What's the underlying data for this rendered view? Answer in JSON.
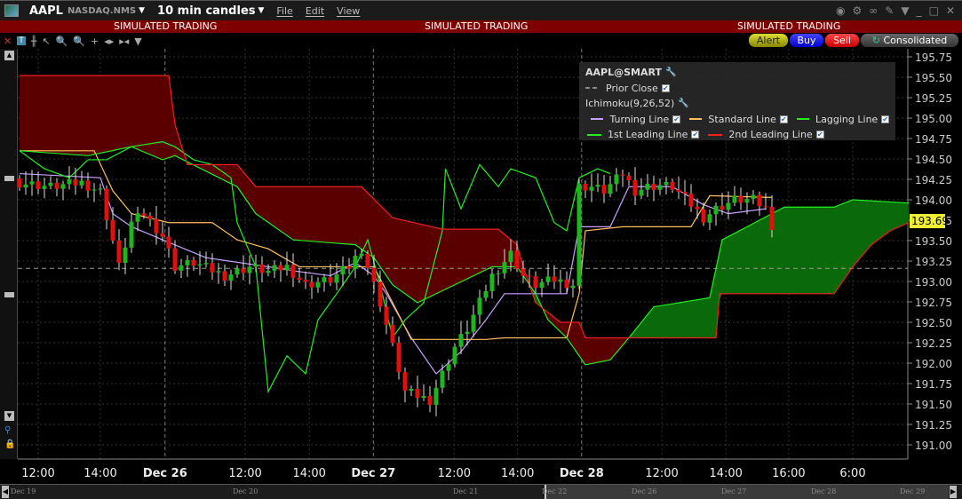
{
  "title": {
    "symbol": "AAPL",
    "exchange": "NASDAQ.NMS",
    "interval": "10 min candles",
    "menus": [
      "File",
      "Edit",
      "View"
    ]
  },
  "sim_banner": "SIMULATED TRADING",
  "buttons": {
    "alert": "Alert",
    "buy": "Buy",
    "sell": "Sell",
    "consolidated": "Consolidated"
  },
  "legend": {
    "header": "AAPL@SMART",
    "prior_close": "Prior Close",
    "study": "Ichimoku(9,26,52)",
    "lines": [
      {
        "label": "Turning Line",
        "color": "#c9a0ff"
      },
      {
        "label": "Standard Line",
        "color": "#ffc060"
      },
      {
        "label": "Lagging Line",
        "color": "#22ee22"
      },
      {
        "label": "1st Leading Line",
        "color": "#22ee22"
      },
      {
        "label": "2nd Leading Line",
        "color": "#ee2020"
      }
    ]
  },
  "current_price": "193.69",
  "navigator": [
    "Dec 19",
    "Dec 20",
    "Dec 21",
    "Dec 22",
    "Dec 26",
    "Dec 27",
    "Dec 28",
    "Dec 29"
  ],
  "chart_data": {
    "type": "candlestick",
    "title": "AAPL 10 min candles",
    "ylim": [
      190.85,
      195.9
    ],
    "xlim": [
      -0.3,
      143
    ],
    "yticks": [
      "195.75",
      "195.50",
      "195.25",
      "195.00",
      "194.75",
      "194.50",
      "194.25",
      "194.00",
      "193.75",
      "193.50",
      "193.25",
      "193.00",
      "192.75",
      "192.50",
      "192.25",
      "192.00",
      "191.75",
      "191.50",
      "191.25",
      "191.00"
    ],
    "xticks": [
      {
        "bar": 3,
        "label": "12:00"
      },
      {
        "bar": 13,
        "label": "14:00"
      },
      {
        "bar": 23.4,
        "label": "Dec 26",
        "bold": true
      },
      {
        "bar": 36.3,
        "label": "12:00"
      },
      {
        "bar": 46.6,
        "label": "14:00"
      },
      {
        "bar": 56.9,
        "label": "Dec 27",
        "bold": true
      },
      {
        "bar": 69.9,
        "label": "12:00"
      },
      {
        "bar": 80.1,
        "label": "14:00"
      },
      {
        "bar": 90.4,
        "label": "Dec 28",
        "bold": true
      },
      {
        "bar": 103.3,
        "label": "12:00"
      },
      {
        "bar": 113.6,
        "label": "14:00"
      },
      {
        "bar": 123.7,
        "label": "16:00"
      },
      {
        "bar": 134,
        "label": "6:00"
      }
    ],
    "prior_close": 193.16,
    "close_path": [
      [
        0,
        194.21
      ],
      [
        5,
        194.16
      ],
      [
        10,
        194.21
      ],
      [
        13,
        194.1
      ],
      [
        15,
        193.5
      ],
      [
        16,
        193.18
      ],
      [
        18,
        193.72
      ],
      [
        20,
        193.83
      ],
      [
        23,
        193.56
      ],
      [
        25,
        193.18
      ],
      [
        28,
        193.23
      ],
      [
        33,
        193.07
      ],
      [
        37,
        193.18
      ],
      [
        40,
        193.12
      ],
      [
        43,
        193.18
      ],
      [
        46,
        192.96
      ],
      [
        50,
        193.02
      ],
      [
        53,
        193.18
      ],
      [
        55,
        193.4
      ],
      [
        56,
        193.18
      ],
      [
        58,
        192.74
      ],
      [
        60,
        192.2
      ],
      [
        62,
        191.65
      ],
      [
        64,
        191.6
      ],
      [
        66,
        191.55
      ],
      [
        68,
        191.87
      ],
      [
        70,
        192.2
      ],
      [
        72,
        192.42
      ],
      [
        74,
        192.74
      ],
      [
        76,
        193.07
      ],
      [
        79,
        193.34
      ],
      [
        81,
        193.07
      ],
      [
        83,
        192.96
      ],
      [
        86,
        193.02
      ],
      [
        89,
        192.96
      ],
      [
        90,
        194.16
      ],
      [
        92,
        194.16
      ],
      [
        94,
        194.11
      ],
      [
        97,
        194.32
      ],
      [
        99,
        194.11
      ],
      [
        101,
        194.16
      ],
      [
        103,
        194.18
      ],
      [
        105,
        194.16
      ],
      [
        108,
        193.94
      ],
      [
        110,
        193.78
      ],
      [
        112,
        193.89
      ],
      [
        115,
        194.0
      ],
      [
        118,
        194.0
      ],
      [
        120,
        193.89
      ],
      [
        121,
        193.69
      ]
    ],
    "series": [
      {
        "name": "Turning Line",
        "points": [
          [
            0,
            194.32
          ],
          [
            13,
            194.27
          ],
          [
            15,
            193.83
          ],
          [
            18,
            193.67
          ],
          [
            23,
            193.51
          ],
          [
            30,
            193.29
          ],
          [
            40,
            193.18
          ],
          [
            45,
            193.12
          ],
          [
            50,
            193.07
          ],
          [
            54,
            193.23
          ],
          [
            57,
            193.07
          ],
          [
            59,
            192.85
          ],
          [
            63,
            192.31
          ],
          [
            67,
            191.87
          ],
          [
            71,
            192.14
          ],
          [
            75,
            192.53
          ],
          [
            78,
            192.85
          ],
          [
            82,
            192.85
          ],
          [
            88,
            192.85
          ],
          [
            90,
            193.67
          ],
          [
            95,
            193.67
          ],
          [
            98,
            194.16
          ],
          [
            105,
            194.16
          ],
          [
            110,
            193.94
          ],
          [
            114,
            193.83
          ],
          [
            120,
            193.89
          ]
        ]
      },
      {
        "name": "Standard Line",
        "points": [
          [
            0,
            194.6
          ],
          [
            12,
            194.6
          ],
          [
            15,
            194.11
          ],
          [
            18,
            193.83
          ],
          [
            24,
            193.72
          ],
          [
            31,
            193.72
          ],
          [
            35,
            193.51
          ],
          [
            40,
            193.4
          ],
          [
            45,
            193.18
          ],
          [
            53,
            193.18
          ],
          [
            57,
            193.18
          ],
          [
            60,
            192.74
          ],
          [
            63,
            192.29
          ],
          [
            68,
            192.29
          ],
          [
            75,
            192.29
          ],
          [
            78,
            192.31
          ],
          [
            88,
            192.31
          ],
          [
            90,
            192.85
          ],
          [
            91,
            193.62
          ],
          [
            97,
            193.67
          ],
          [
            108,
            193.67
          ],
          [
            111,
            194.05
          ],
          [
            120,
            194.03
          ],
          [
            121,
            194.03
          ]
        ]
      },
      {
        "name": "Lagging Line",
        "points": [
          [
            0,
            194.6
          ],
          [
            4,
            194.38
          ],
          [
            8,
            194.27
          ],
          [
            11,
            194.49
          ],
          [
            14,
            194.49
          ],
          [
            18,
            194.65
          ],
          [
            23,
            194.71
          ],
          [
            25,
            194.65
          ],
          [
            28,
            194.49
          ],
          [
            31,
            194.43
          ],
          [
            34,
            194.27
          ],
          [
            35,
            193.72
          ],
          [
            38,
            193.18
          ],
          [
            40,
            191.65
          ],
          [
            43,
            192.09
          ],
          [
            46,
            191.87
          ],
          [
            48,
            192.53
          ],
          [
            51,
            192.85
          ],
          [
            54,
            193.18
          ],
          [
            56,
            193.51
          ],
          [
            58,
            192.96
          ],
          [
            60,
            192.31
          ],
          [
            62,
            192.53
          ],
          [
            65,
            192.74
          ],
          [
            68,
            193.62
          ],
          [
            68.5,
            194.38
          ],
          [
            71,
            193.89
          ],
          [
            74,
            194.43
          ],
          [
            77,
            194.16
          ],
          [
            79,
            194.38
          ],
          [
            83,
            194.27
          ],
          [
            86,
            193.72
          ],
          [
            88,
            193.62
          ],
          [
            90,
            194.27
          ],
          [
            93,
            194.38
          ],
          [
            95,
            194.32
          ]
        ]
      },
      {
        "name": "1st Leading Line",
        "points": [
          [
            0,
            194.6
          ],
          [
            11,
            194.54
          ],
          [
            18,
            194.65
          ],
          [
            23,
            194.49
          ],
          [
            25,
            194.54
          ],
          [
            35,
            194.16
          ],
          [
            38,
            193.83
          ],
          [
            44,
            193.51
          ],
          [
            54,
            193.45
          ],
          [
            57,
            193.29
          ],
          [
            60,
            192.96
          ],
          [
            64,
            192.74
          ],
          [
            76,
            193.18
          ],
          [
            80,
            193.18
          ],
          [
            83,
            192.85
          ],
          [
            85,
            192.53
          ],
          [
            88,
            192.31
          ],
          [
            91,
            191.98
          ],
          [
            95,
            192.04
          ],
          [
            98,
            192.31
          ],
          [
            102,
            192.69
          ],
          [
            111,
            192.8
          ],
          [
            113,
            193.51
          ],
          [
            117,
            193.67
          ],
          [
            123,
            193.91
          ],
          [
            131,
            193.91
          ],
          [
            134,
            194.0
          ],
          [
            143,
            193.96
          ]
        ]
      },
      {
        "name": "2nd Leading Line",
        "points": [
          [
            0,
            195.52
          ],
          [
            24,
            195.52
          ],
          [
            25,
            194.92
          ],
          [
            27,
            194.43
          ],
          [
            35,
            194.43
          ],
          [
            38,
            194.16
          ],
          [
            55,
            194.16
          ],
          [
            60,
            193.78
          ],
          [
            68,
            193.64
          ],
          [
            77,
            193.64
          ],
          [
            80,
            193.45
          ],
          [
            81,
            193.18
          ],
          [
            83,
            192.74
          ],
          [
            87,
            192.5
          ],
          [
            90,
            192.5
          ],
          [
            91,
            192.31
          ],
          [
            112,
            192.31
          ],
          [
            112.6,
            192.85
          ],
          [
            131,
            192.85
          ],
          [
            134,
            193.18
          ],
          [
            137,
            193.45
          ],
          [
            140,
            193.62
          ],
          [
            143,
            193.72
          ]
        ]
      }
    ]
  }
}
